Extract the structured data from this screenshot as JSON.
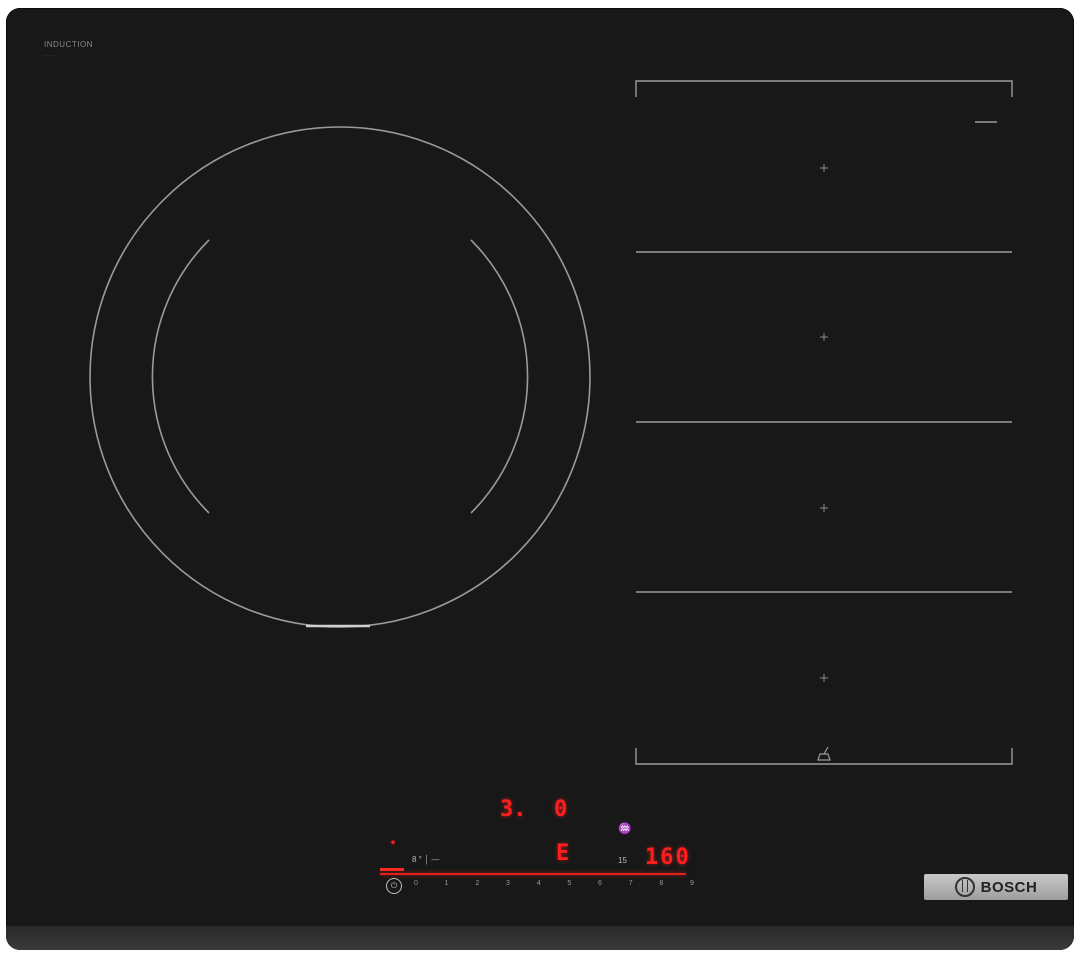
{
  "brand": {
    "top_left_label": "INDUCTION",
    "top_left_sub": "......",
    "logo_text": "BOSCH"
  },
  "controls": {
    "power_level_display": "3.",
    "timer_display": "0",
    "mode_display": "E",
    "temperature_display": "160",
    "left_indicator": "•",
    "timer_label": "8 ° │ ―",
    "frying_label": "15",
    "pan_icon": "♒",
    "power_icon": "⏻",
    "scale": [
      "0",
      "1",
      "2",
      "3",
      "4",
      "5",
      "6",
      "7",
      "8",
      "9"
    ]
  },
  "colors": {
    "glass": "#181818",
    "led_red": "#ff1e1e",
    "line": "#9a9a9a"
  }
}
